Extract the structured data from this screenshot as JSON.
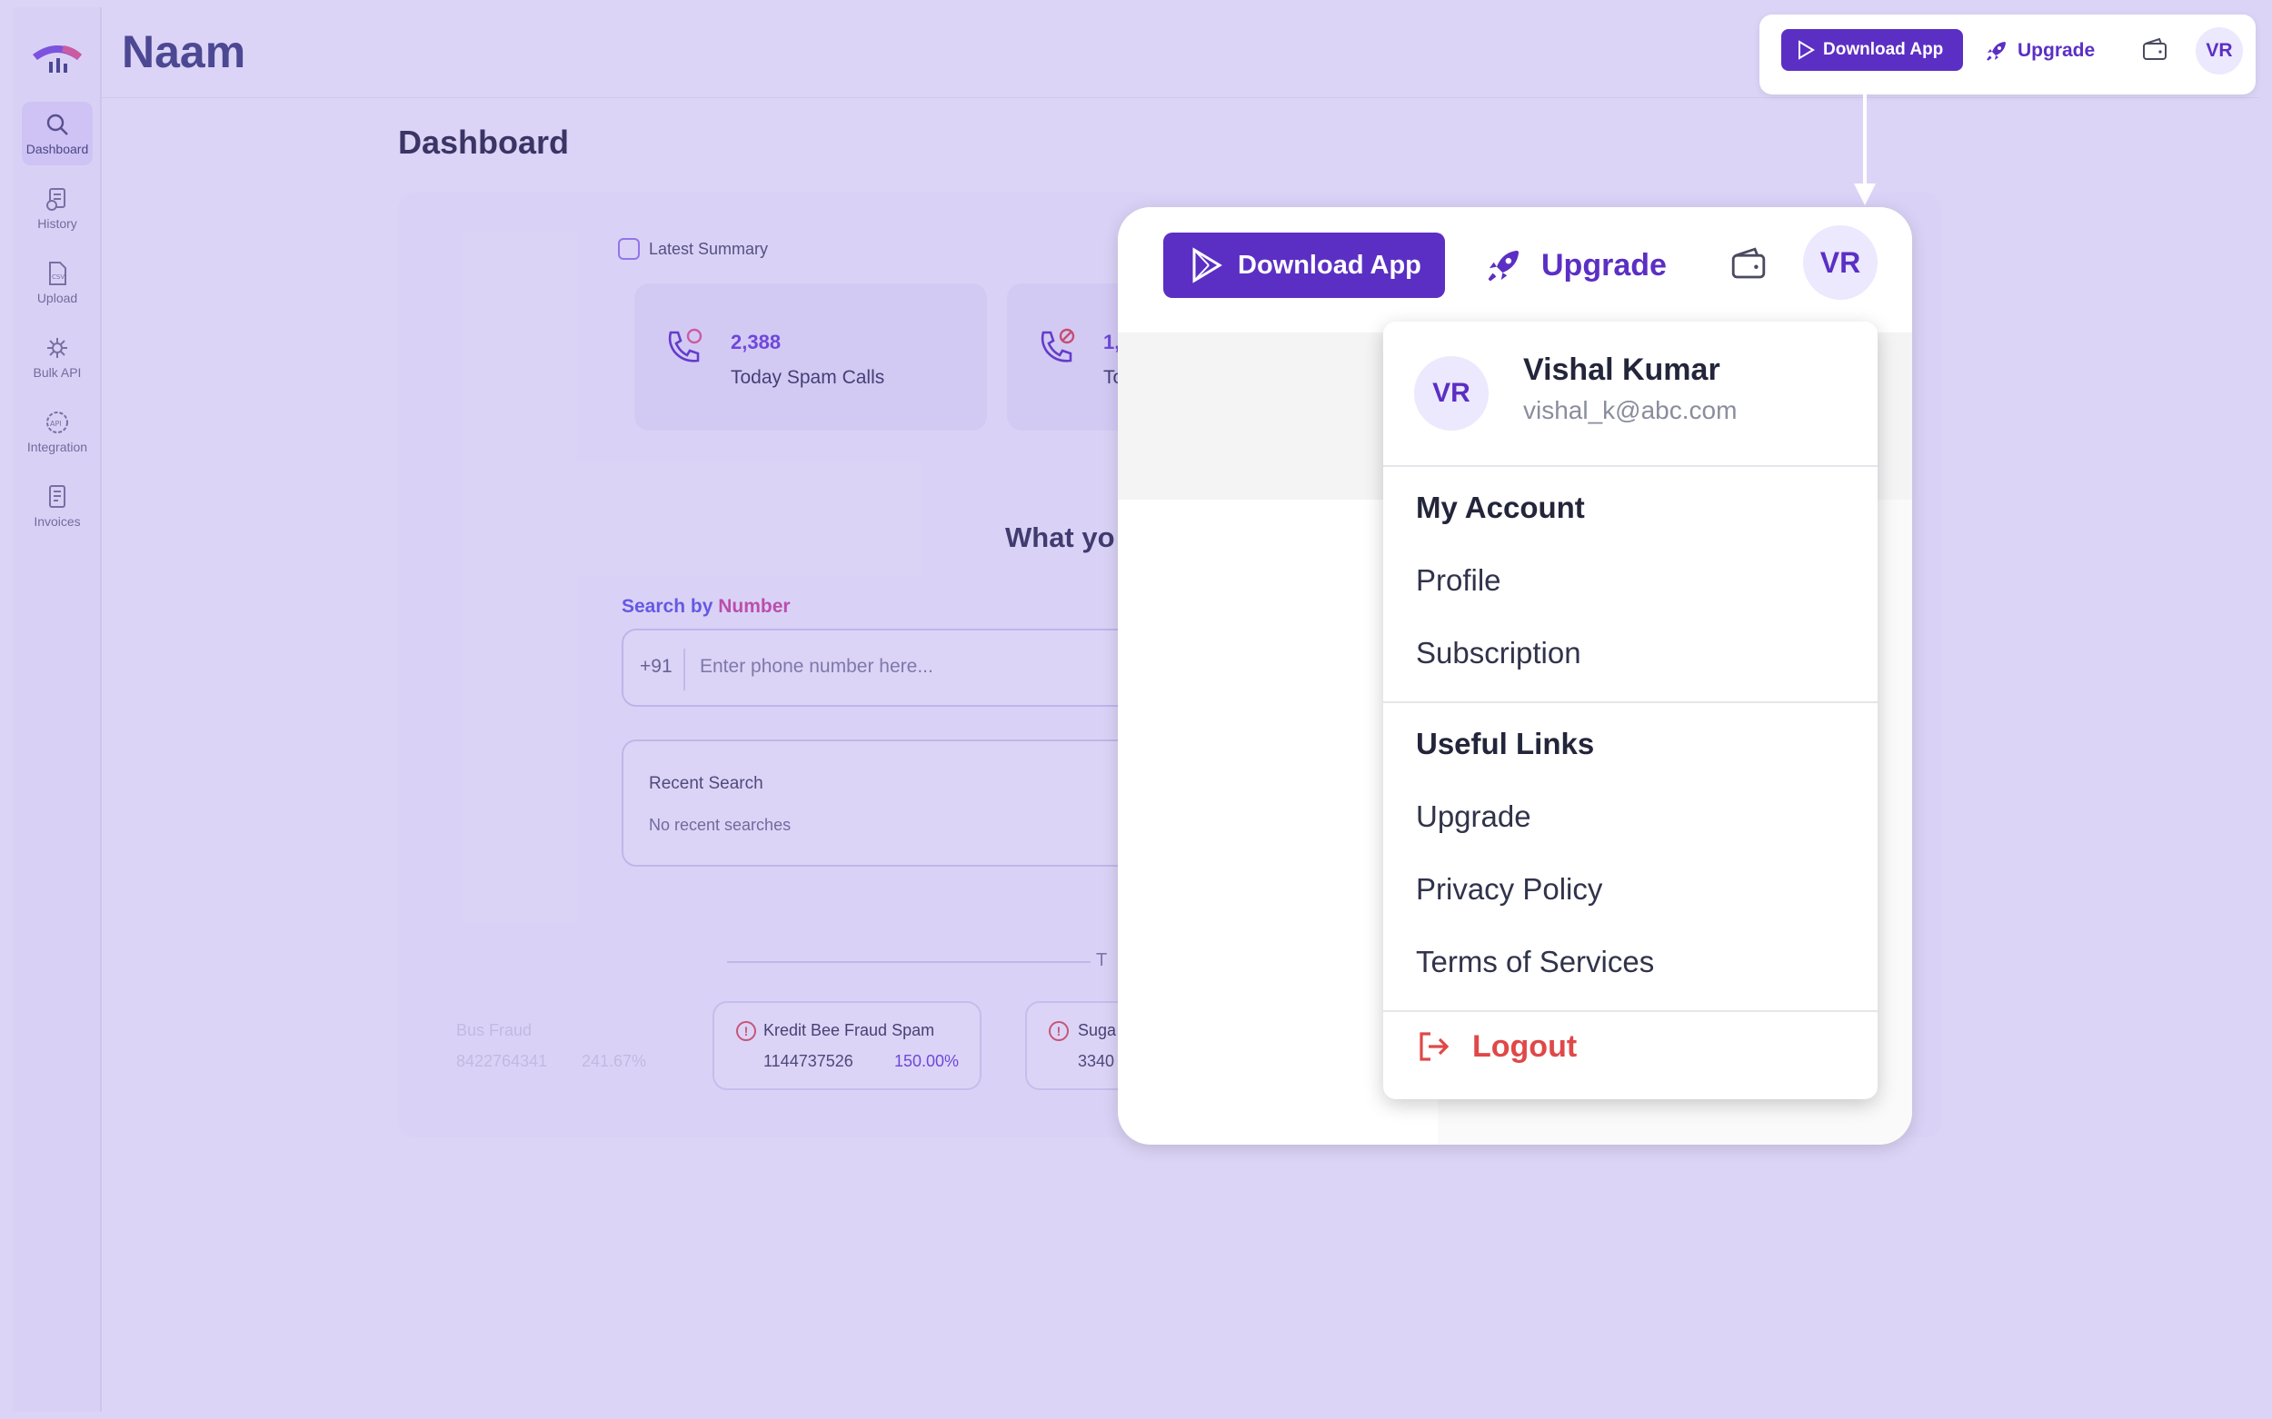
{
  "app": {
    "name": "Naam"
  },
  "sidebar": {
    "items": [
      {
        "label": "Dashboard",
        "icon": "search-icon",
        "active": true
      },
      {
        "label": "History",
        "icon": "history-icon"
      },
      {
        "label": "Upload",
        "icon": "csv-file-icon"
      },
      {
        "label": "Bulk API",
        "icon": "bulk-api-icon"
      },
      {
        "label": "Integration",
        "icon": "api-icon"
      },
      {
        "label": "Invoices",
        "icon": "invoice-icon"
      }
    ]
  },
  "header": {
    "download_label": "Download App",
    "upgrade_label": "Upgrade",
    "avatar_initials": "VR"
  },
  "dashboard": {
    "title": "Dashboard",
    "summary_label": "Latest Summary",
    "stats": [
      {
        "value": "2,388",
        "label": "Today Spam Calls"
      },
      {
        "value": "1,",
        "label": "To"
      }
    ],
    "question": "What yo",
    "search": {
      "label_prefix": "Search by",
      "label_highlight": "Number",
      "country_code": "+91",
      "placeholder": "Enter phone number here..."
    },
    "recent": {
      "title": "Recent Search",
      "empty": "No recent searches"
    },
    "trending_letter": "T",
    "trending": [
      {
        "title": "Kredit Bee Fraud Spam",
        "number": "1144737526",
        "percent": "150.00%"
      },
      {
        "title": "Suga",
        "number": "3340"
      }
    ],
    "faded_trending": {
      "title": "Bus Fraud",
      "number": "8422764341",
      "percent": "241.67%"
    }
  },
  "profile_menu": {
    "initials": "VR",
    "name": "Vishal Kumar",
    "email": "vishal_k@abc.com",
    "account_header": "My Account",
    "account_items": [
      "Profile",
      "Subscription"
    ],
    "links_header": "Useful Links",
    "links_items": [
      "Upgrade",
      "Privacy Policy",
      "Terms of Services"
    ],
    "logout_label": "Logout"
  },
  "colors": {
    "accent": "#5b2fc4",
    "overlay": "#7c60de",
    "danger": "#e04848",
    "light_accent": "#ece8fd"
  }
}
